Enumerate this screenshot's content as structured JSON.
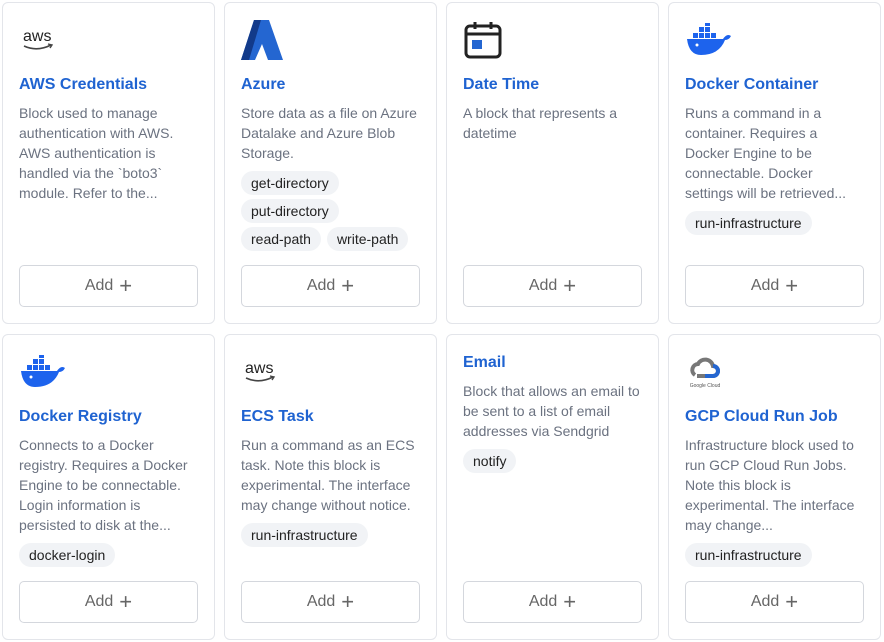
{
  "add_label": "Add",
  "cards": [
    {
      "title": "AWS Credentials",
      "icon": "aws-logo",
      "logo_text": "aws",
      "desc": "Block used to manage authentication with AWS. AWS authentication is handled via the `boto3` module. Refer to the...",
      "tags": []
    },
    {
      "title": "Azure",
      "icon": "azure-logo",
      "desc": "Store data as a file on Azure Datalake and Azure Blob Storage.",
      "tags": [
        "get-directory",
        "put-directory",
        "read-path",
        "write-path"
      ]
    },
    {
      "title": "Date Time",
      "icon": "calendar-icon",
      "desc": "A block that represents a datetime",
      "tags": []
    },
    {
      "title": "Docker Container",
      "icon": "docker-logo",
      "desc": "Runs a command in a container. Requires a Docker Engine to be connectable. Docker settings will be retrieved...",
      "tags": [
        "run-infrastructure"
      ]
    },
    {
      "title": "Docker Registry",
      "icon": "docker-logo",
      "desc": "Connects to a Docker registry. Requires a Docker Engine to be connectable. Login information is persisted to disk at the...",
      "tags": [
        "docker-login"
      ]
    },
    {
      "title": "ECS Task",
      "icon": "aws-logo",
      "logo_text": "aws",
      "desc": "Run a command as an ECS task. Note this block is experimental. The interface may change without notice.",
      "tags": [
        "run-infrastructure"
      ]
    },
    {
      "title": "Email",
      "icon": "",
      "desc": "Block that allows an email to be sent to a list of email addresses via Sendgrid",
      "tags": [
        "notify"
      ]
    },
    {
      "title": "GCP Cloud Run Job",
      "icon": "google-cloud-logo",
      "logo_text": "Google Cloud",
      "desc": "Infrastructure block used to run GCP Cloud Run Jobs. Note this block is experimental. The interface may change...",
      "tags": [
        "run-infrastructure"
      ]
    }
  ]
}
